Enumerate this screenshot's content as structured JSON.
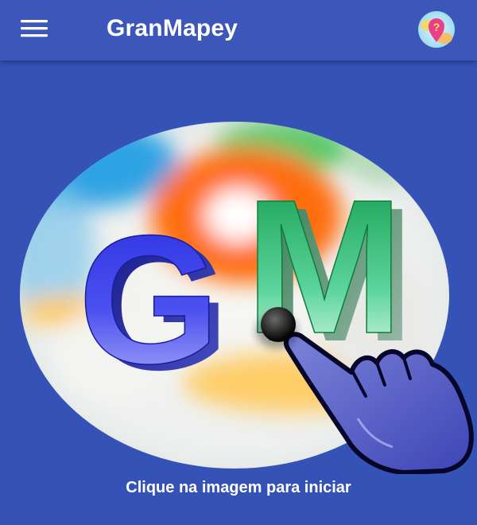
{
  "app": {
    "title": "GranMapey"
  },
  "header": {
    "menu_icon": "hamburger-menu-icon",
    "help_icon": "map-pin-question-icon"
  },
  "logo": {
    "letters": [
      "G",
      "M"
    ],
    "pointer_icon": "pointing-hand-icon",
    "colors": {
      "background": "#3552b7",
      "g_letter": "#3b3fe8",
      "m_letter": "#1fa35a",
      "hand": "#5b63c8"
    }
  },
  "hint": {
    "text": "Clique na imagem para iniciar"
  }
}
